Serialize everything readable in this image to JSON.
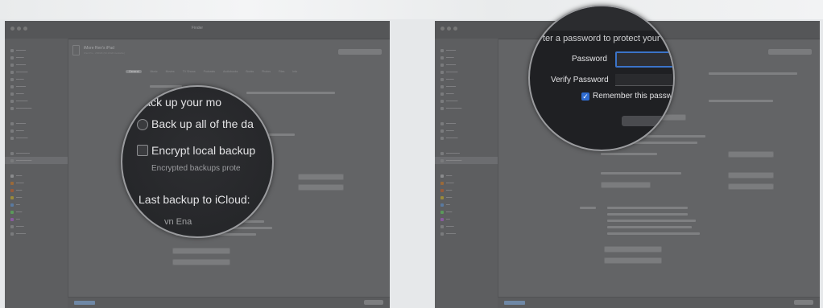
{
  "left_window": {
    "title": "Finder",
    "device": {
      "name": "iMore Ren's iPad",
      "sub": "iPad Pro · 256GB (50.16GB Available)"
    },
    "manage_storage": "Manage Storage…",
    "tabs": [
      "General",
      "Music",
      "Movies",
      "TV Shows",
      "Podcasts",
      "Audiobooks",
      "Books",
      "Photos",
      "Files",
      "Info"
    ],
    "magnifier": {
      "line1": "Back up your mo",
      "line2": "Back up all of the da",
      "line3": "Encrypt local backup",
      "line4": "Encrypted backups prote",
      "line5": "Last backup to iCloud:",
      "line6": "vn Ena"
    }
  },
  "right_window": {
    "title": "Finder",
    "magnifier": {
      "line1": "ter a password to protect your",
      "password_label": "Password",
      "verify_label": "Verify Password",
      "remember_label": "Remember this passwo"
    }
  },
  "colors": {
    "accent": "#2f6cd1",
    "window_bg": "#636466",
    "magnifier_bg": "#26272a"
  }
}
